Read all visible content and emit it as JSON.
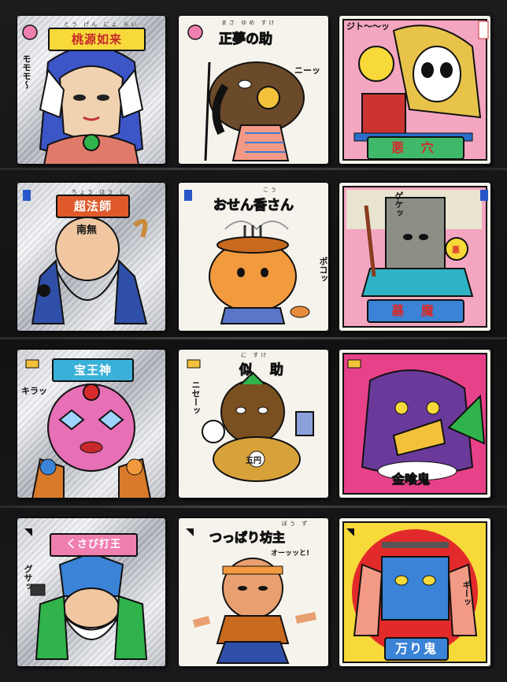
{
  "stickers": [
    {
      "name": "桃源如来",
      "ruby": "とう げん にょ らい",
      "sfx": "モモモ〜",
      "sfx2": ""
    },
    {
      "name": "正夢の助",
      "ruby": "まさ ゆめ すけ",
      "sfx": "ニーッ",
      "sfx2": ""
    },
    {
      "name": "悪 穴",
      "ruby": "",
      "sfx": "ジト〜〜ッ",
      "sfx2": ""
    },
    {
      "name": "超法師",
      "ruby": "ちょう ほう し",
      "sfx": "",
      "sfx2": "",
      "kanji": "南無"
    },
    {
      "name": "おせん香さん",
      "ruby": "こう",
      "sfx": "ポコッ",
      "sfx2": ""
    },
    {
      "name": "墓 魔",
      "ruby": "",
      "sfx": "ゲケッ",
      "sfx2": "",
      "kanji": "悪"
    },
    {
      "name": "宝王神",
      "ruby": "",
      "sfx": "キラッ",
      "sfx2": ""
    },
    {
      "name": "似 助",
      "ruby": "に すけ",
      "sfx": "ニセーッ",
      "sfx2": "",
      "kanji": "五円"
    },
    {
      "name": "金喰鬼",
      "ruby": "",
      "sfx": "",
      "sfx2": ""
    },
    {
      "name": "くさび打王",
      "ruby": "",
      "sfx": "グサッ",
      "sfx2": ""
    },
    {
      "name": "つっぱり坊主",
      "ruby": "ぼう ず",
      "sfx": "オーッッと!",
      "sfx2": ""
    },
    {
      "name": "万り鬼",
      "ruby": "",
      "sfx": "ギーッ",
      "sfx2": ""
    }
  ]
}
